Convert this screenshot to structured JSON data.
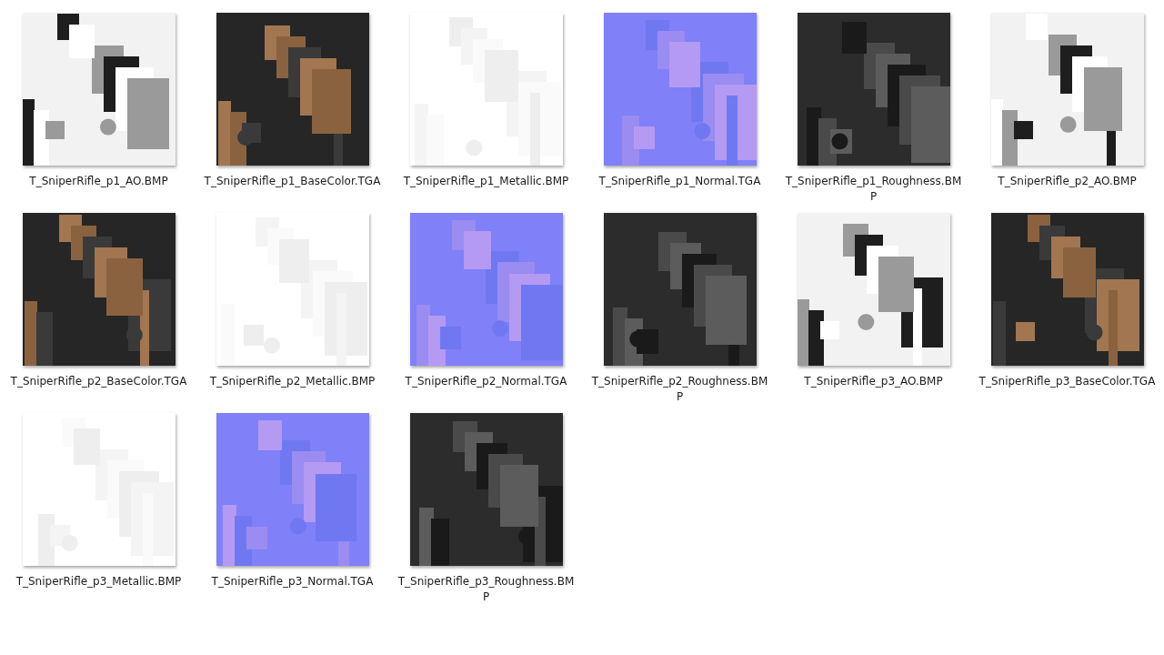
{
  "files": [
    {
      "name": "T_SniperRifle_p1_AO.BMP",
      "kind": "picture"
    },
    {
      "name": "T_SniperRifle_p1_BaseColor.TGA",
      "kind": "picture"
    },
    {
      "name": "T_SniperRifle_p1_Metallic.BMP",
      "kind": "picture"
    },
    {
      "name": "T_SniperRifle_p1_Normal.TGA",
      "kind": "picture"
    },
    {
      "name": "T_SniperRifle_p1_Roughness.BMP",
      "kind": "picture"
    },
    {
      "name": "T_SniperRifle_p2_AO.BMP",
      "kind": "picture"
    },
    {
      "name": "T_SniperRifle_p2_BaseColor.TGA",
      "kind": "picture"
    },
    {
      "name": "T_SniperRifle_p2_Metallic.BMP",
      "kind": "picture"
    },
    {
      "name": "T_SniperRifle_p2_Normal.TGA",
      "kind": "picture"
    },
    {
      "name": "T_SniperRifle_p2_Roughness.BMP",
      "kind": "picture"
    },
    {
      "name": "T_SniperRifle_p3_AO.BMP",
      "kind": "picture"
    },
    {
      "name": "T_SniperRifle_p3_BaseColor.TGA",
      "kind": "picture"
    },
    {
      "name": "T_SniperRifle_p3_Metallic.BMP",
      "kind": "picture"
    },
    {
      "name": "T_SniperRifle_p3_Normal.TGA",
      "kind": "picture"
    },
    {
      "name": "T_SniperRifle_p3_Roughness.BMP",
      "kind": "picture"
    }
  ]
}
